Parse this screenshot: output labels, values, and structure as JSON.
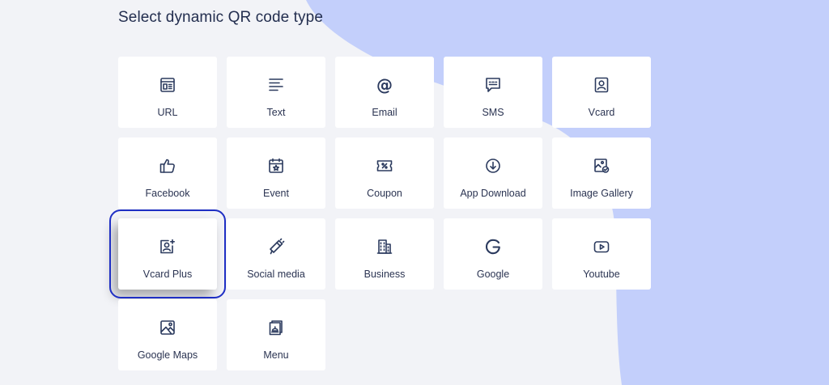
{
  "page": {
    "title": "Select dynamic QR code type"
  },
  "colors": {
    "background": "#f2f3f7",
    "blob": "#c3cffb",
    "card": "#ffffff",
    "selection_outline": "#1f2fc4",
    "icon": "#2b3a5e"
  },
  "qr_types": [
    {
      "label": "URL",
      "icon": "browser-window-icon"
    },
    {
      "label": "Text",
      "icon": "text-lines-icon"
    },
    {
      "label": "Email",
      "icon": "at-sign-icon"
    },
    {
      "label": "SMS",
      "icon": "sms-bubble-icon"
    },
    {
      "label": "Vcard",
      "icon": "contact-card-icon"
    },
    {
      "label": "Facebook",
      "icon": "thumbs-up-icon"
    },
    {
      "label": "Event",
      "icon": "calendar-star-icon"
    },
    {
      "label": "Coupon",
      "icon": "coupon-percent-icon"
    },
    {
      "label": "App Download",
      "icon": "download-circle-icon"
    },
    {
      "label": "Image Gallery",
      "icon": "image-gallery-icon"
    },
    {
      "label": "Vcard Plus",
      "icon": "contact-plus-icon"
    },
    {
      "label": "Social media",
      "icon": "megaphone-icon"
    },
    {
      "label": "Business",
      "icon": "building-icon"
    },
    {
      "label": "Google",
      "icon": "google-g-icon"
    },
    {
      "label": "Youtube",
      "icon": "play-button-icon"
    },
    {
      "label": "Google Maps",
      "icon": "map-image-icon"
    },
    {
      "label": "Menu",
      "icon": "menu-document-icon"
    }
  ],
  "selected": "Vcard Plus"
}
